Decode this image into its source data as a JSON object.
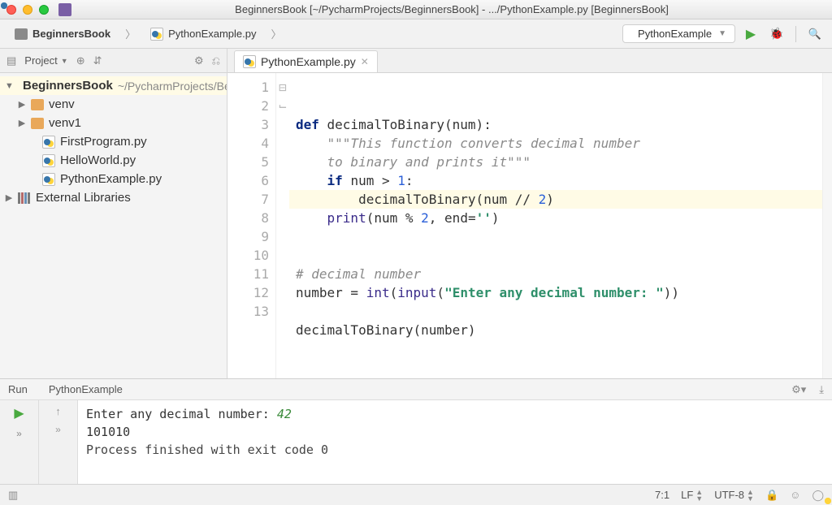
{
  "titlebar": {
    "title": "BeginnersBook [~/PycharmProjects/BeginnersBook] - .../PythonExample.py [BeginnersBook]"
  },
  "breadcrumbs": {
    "project": "BeginnersBook",
    "file": "PythonExample.py"
  },
  "run_config": {
    "selected": "PythonExample"
  },
  "project_tool": {
    "label": "Project"
  },
  "tree": {
    "root": {
      "name": "BeginnersBook",
      "path": "~/PycharmProjects/BeginnersBook"
    },
    "folders": [
      {
        "name": "venv"
      },
      {
        "name": "venv1"
      }
    ],
    "files": [
      {
        "name": "FirstProgram.py"
      },
      {
        "name": "HelloWorld.py"
      },
      {
        "name": "PythonExample.py"
      }
    ],
    "external": "External Libraries"
  },
  "tabs": {
    "active": "PythonExample.py"
  },
  "code": {
    "lines": [
      "1",
      "2",
      "3",
      "4",
      "5",
      "6",
      "7",
      "8",
      "9",
      "10",
      "11",
      "12",
      "13"
    ],
    "l1_kw": "def ",
    "l1_fn": "decimalToBinary(num):",
    "l2": "    \"\"\"This function converts decimal number",
    "l3": "    to binary and prints it\"\"\"",
    "l4_kw": "    if ",
    "l4_rest": "num > ",
    "l4_num": "1",
    "l4_colon": ":",
    "l5_pre": "        decimalToBinary(num // ",
    "l5_num": "2",
    "l5_post": ")",
    "l6_pre": "    ",
    "l6_fn": "print",
    "l6_mid": "(num % ",
    "l6_num": "2",
    "l6_end": ", end=",
    "l6_str": "''",
    "l6_close": ")",
    "l7": "",
    "l8": "",
    "l9": "# decimal number",
    "l10_a": "number = ",
    "l10_int": "int",
    "l10_b": "(",
    "l10_input": "input",
    "l10_c": "(",
    "l10_str": "\"Enter any decimal number: \"",
    "l10_d": "))",
    "l11": "",
    "l12": "decimalToBinary(number)",
    "l13": ""
  },
  "run": {
    "label": "Run",
    "config": "PythonExample",
    "out_prompt": "Enter any decimal number: ",
    "out_input": "42",
    "out_result": "101010",
    "out_exit": "Process finished with exit code 0"
  },
  "status": {
    "caret": "7:1",
    "line_sep": "LF",
    "encoding": "UTF-8"
  }
}
